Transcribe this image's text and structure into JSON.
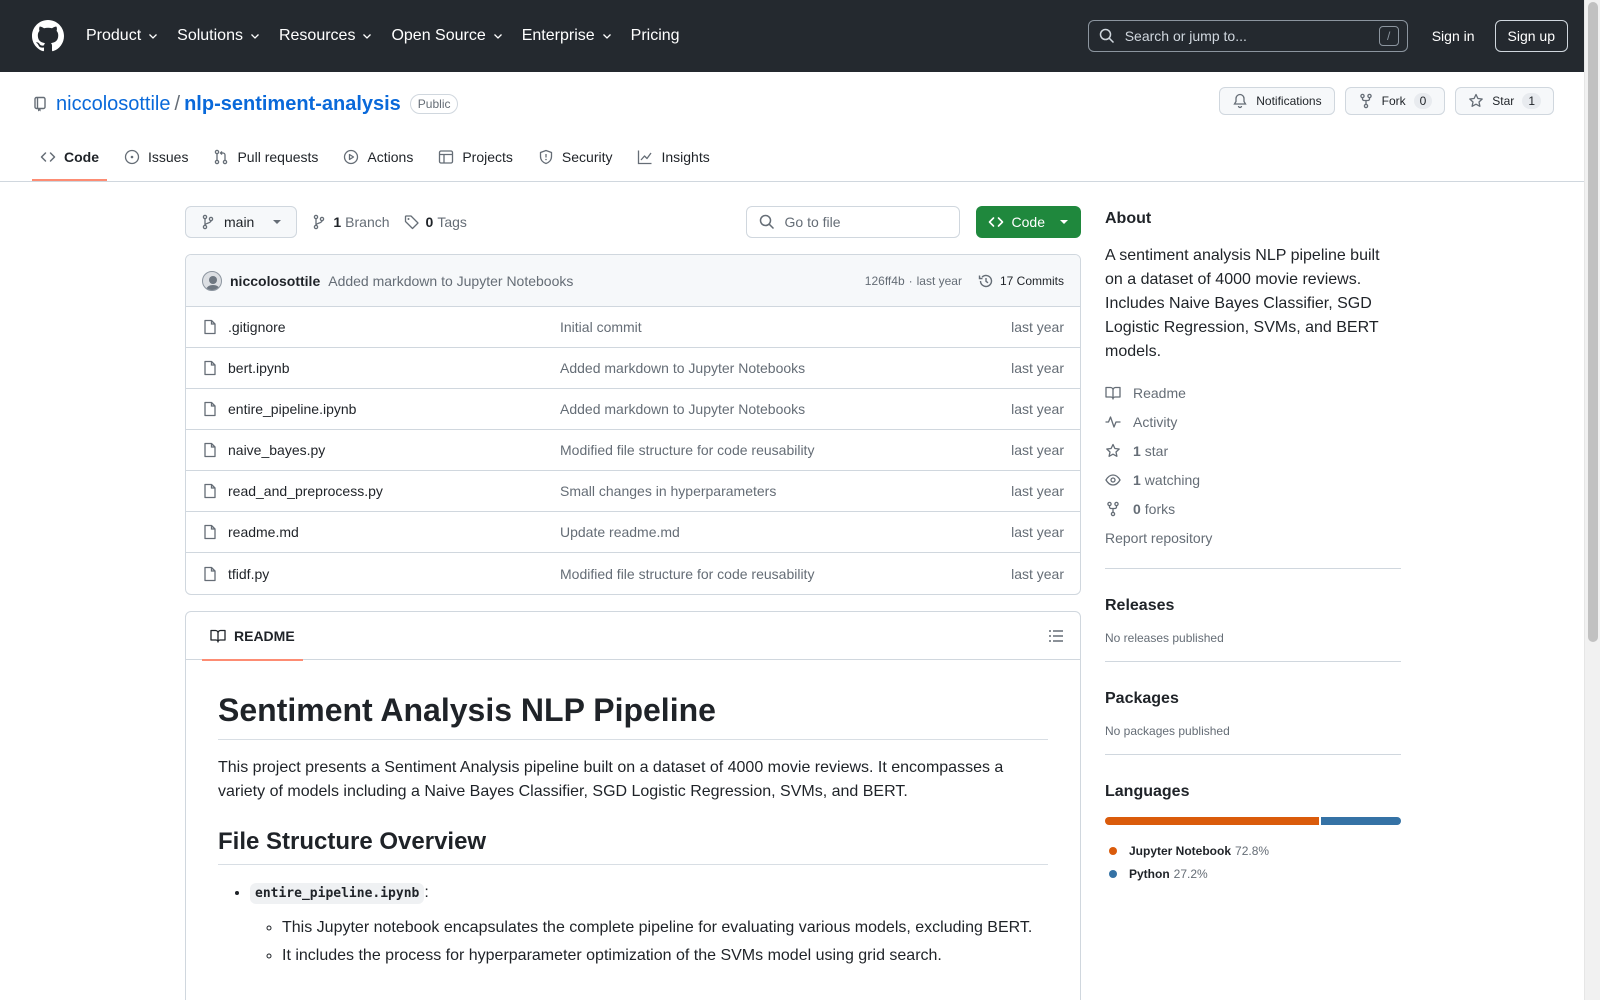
{
  "header": {
    "nav": [
      {
        "label": "Product",
        "has_menu": true
      },
      {
        "label": "Solutions",
        "has_menu": true
      },
      {
        "label": "Resources",
        "has_menu": true
      },
      {
        "label": "Open Source",
        "has_menu": true
      },
      {
        "label": "Enterprise",
        "has_menu": true
      },
      {
        "label": "Pricing",
        "has_menu": false
      }
    ],
    "search_placeholder": "Search or jump to...",
    "search_shortcut": "/",
    "sign_in": "Sign in",
    "sign_up": "Sign up"
  },
  "repo": {
    "owner": "niccolosottile",
    "separator": "/",
    "name": "nlp-sentiment-analysis",
    "visibility": "Public",
    "notifications_label": "Notifications",
    "fork_label": "Fork",
    "fork_count": "0",
    "star_label": "Star",
    "star_count": "1"
  },
  "tabs": [
    {
      "label": "Code",
      "icon": "code-icon",
      "active": true
    },
    {
      "label": "Issues",
      "icon": "issue-icon",
      "active": false
    },
    {
      "label": "Pull requests",
      "icon": "pull-request-icon",
      "active": false
    },
    {
      "label": "Actions",
      "icon": "play-icon",
      "active": false
    },
    {
      "label": "Projects",
      "icon": "table-icon",
      "active": false
    },
    {
      "label": "Security",
      "icon": "shield-icon",
      "active": false
    },
    {
      "label": "Insights",
      "icon": "graph-icon",
      "active": false
    }
  ],
  "toolbar": {
    "branch": "main",
    "branch_count": "1",
    "branch_label": "Branch",
    "tag_count": "0",
    "tag_label": "Tags",
    "goto_placeholder": "Go to file",
    "code_label": "Code"
  },
  "latest_commit": {
    "author": "niccolosottile",
    "message": "Added markdown to Jupyter Notebooks",
    "sha": "126ff4b",
    "dot": "·",
    "time": "last year",
    "commits_label": "17 Commits"
  },
  "files": [
    {
      "name": ".gitignore",
      "message": "Initial commit",
      "time": "last year"
    },
    {
      "name": "bert.ipynb",
      "message": "Added markdown to Jupyter Notebooks",
      "time": "last year"
    },
    {
      "name": "entire_pipeline.ipynb",
      "message": "Added markdown to Jupyter Notebooks",
      "time": "last year"
    },
    {
      "name": "naive_bayes.py",
      "message": "Modified file structure for code reusability",
      "time": "last year"
    },
    {
      "name": "read_and_preprocess.py",
      "message": "Small changes in hyperparameters",
      "time": "last year"
    },
    {
      "name": "readme.md",
      "message": "Update readme.md",
      "time": "last year"
    },
    {
      "name": "tfidf.py",
      "message": "Modified file structure for code reusability",
      "time": "last year"
    }
  ],
  "readme": {
    "tab_label": "README",
    "title": "Sentiment Analysis NLP Pipeline",
    "intro": "This project presents a Sentiment Analysis pipeline built on a dataset of 4000 movie reviews. It encompasses a variety of models including a Naive Bayes Classifier, SGD Logistic Regression, SVMs, and BERT.",
    "section_title": "File Structure Overview",
    "item_code": "entire_pipeline.ipynb",
    "item_colon": ":",
    "sub_items": [
      "This Jupyter notebook encapsulates the complete pipeline for evaluating various models, excluding BERT.",
      "It includes the process for hyperparameter optimization of the SVMs model using grid search."
    ]
  },
  "about": {
    "title": "About",
    "description": "A sentiment analysis NLP pipeline built on a dataset of 4000 movie reviews. Includes Naive Bayes Classifier, SGD Logistic Regression, SVMs, and BERT models.",
    "readme": "Readme",
    "activity": "Activity",
    "stars_count": "1",
    "stars_label": "star",
    "watching_count": "1",
    "watching_label": "watching",
    "forks_count": "0",
    "forks_label": "forks",
    "report": "Report repository"
  },
  "releases": {
    "title": "Releases",
    "empty": "No releases published"
  },
  "packages": {
    "title": "Packages",
    "empty": "No packages published"
  },
  "languages": {
    "title": "Languages",
    "items": [
      {
        "name": "Jupyter Notebook",
        "percent": "72.8%",
        "value": 72.8,
        "color": "#DA5B0B"
      },
      {
        "name": "Python",
        "percent": "27.2%",
        "value": 27.2,
        "color": "#3572A5"
      }
    ]
  },
  "colors": {
    "header_bg": "#24292f",
    "link": "#0969da",
    "primary_button": "#1f883d",
    "active_tab_underline": "#fd8c73"
  }
}
